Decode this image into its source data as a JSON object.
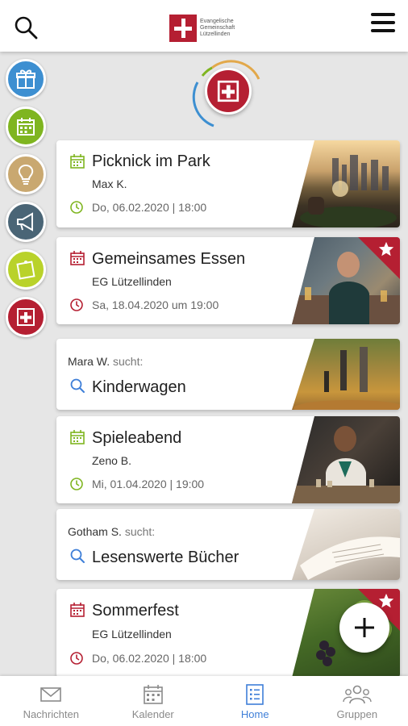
{
  "header": {
    "logo_lines": [
      "Evangelische",
      "Gemeinschaft",
      "Lützellinden"
    ]
  },
  "rail": [
    {
      "icon": "gift-icon",
      "color": "#3d8fd1"
    },
    {
      "icon": "calendar-icon",
      "color": "#7fb520"
    },
    {
      "icon": "lightbulb-icon",
      "color": "#c9a870"
    },
    {
      "icon": "megaphone-icon",
      "color": "#4a6576"
    },
    {
      "icon": "note-icon",
      "color": "#b9d22a"
    },
    {
      "icon": "church-cross-icon",
      "color": "#b51f32"
    }
  ],
  "cards": {
    "c1": {
      "title": "Picknick im Park",
      "author": "Max K.",
      "when": "Do, 06.02.2020 | 18:00"
    },
    "c2": {
      "title": "Gemeinsames Essen",
      "author": "EG Lützellinden",
      "when": "Sa, 18.04.2020 um 19:00"
    },
    "c3": {
      "seeker": "Mara W.",
      "verb": "sucht:",
      "title": "Kinderwagen"
    },
    "c4": {
      "title": "Spieleabend",
      "author": "Zeno B.",
      "when": "Mi, 01.04.2020 | 19:00"
    },
    "c5": {
      "seeker": "Gotham S.",
      "verb": "sucht:",
      "title": "Lesenswerte Bücher"
    },
    "c6": {
      "title": "Sommerfest",
      "author": "EG Lützellinden",
      "when": "Do, 06.02.2020 | 18:00"
    }
  },
  "colors": {
    "green": "#7fb520",
    "red": "#b51f32",
    "blue": "#3f7fd8"
  },
  "nav": [
    {
      "label": "Nachrichten",
      "icon": "envelope-icon"
    },
    {
      "label": "Kalender",
      "icon": "calendar-icon"
    },
    {
      "label": "Home",
      "icon": "list-icon"
    },
    {
      "label": "Gruppen",
      "icon": "people-icon"
    }
  ]
}
